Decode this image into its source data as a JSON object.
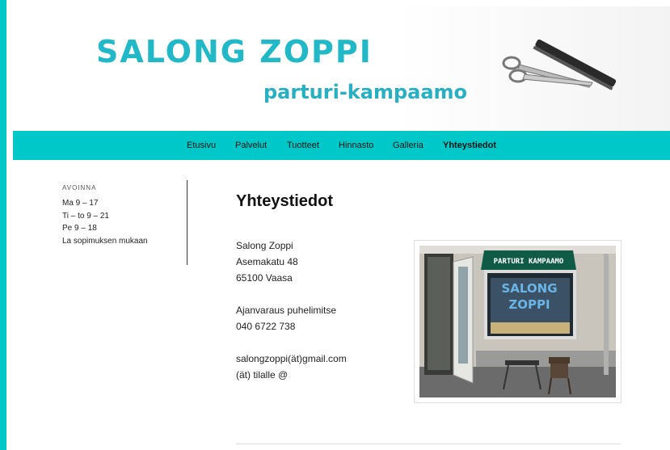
{
  "header": {
    "title": "SALONG ZOPPI",
    "subtitle": "parturi-kampaamo",
    "brand_color": "#21b8c7",
    "accent_color": "#00c8c8",
    "logo_icon": "scissors-and-comb-icon"
  },
  "nav": {
    "items": [
      {
        "label": "Etusivu"
      },
      {
        "label": "Palvelut"
      },
      {
        "label": "Tuotteet"
      },
      {
        "label": "Hinnasto"
      },
      {
        "label": "Galleria"
      },
      {
        "label": "Yhteystiedot",
        "active": true
      }
    ]
  },
  "sidebar": {
    "title": "AVOINNA",
    "hours": [
      "Ma 9 – 17",
      "Ti – to 9 – 21",
      "Pe 9 – 18",
      "La sopimuksen mukaan"
    ]
  },
  "main": {
    "title": "Yhteystiedot",
    "address": [
      "Salong Zoppi",
      "Asemakatu 48",
      "65100 Vaasa"
    ],
    "phone_label": "Ajanvaraus puhelimitse",
    "phone": "040 6722 738",
    "email": "salongzoppi(ät)gmail.com",
    "email_note": "(ät) tilalle @",
    "photo": {
      "awning_text": "PARTURI KAMPAAMO",
      "window_text_1": "SALONG",
      "window_text_2": "ZOPPI"
    }
  }
}
